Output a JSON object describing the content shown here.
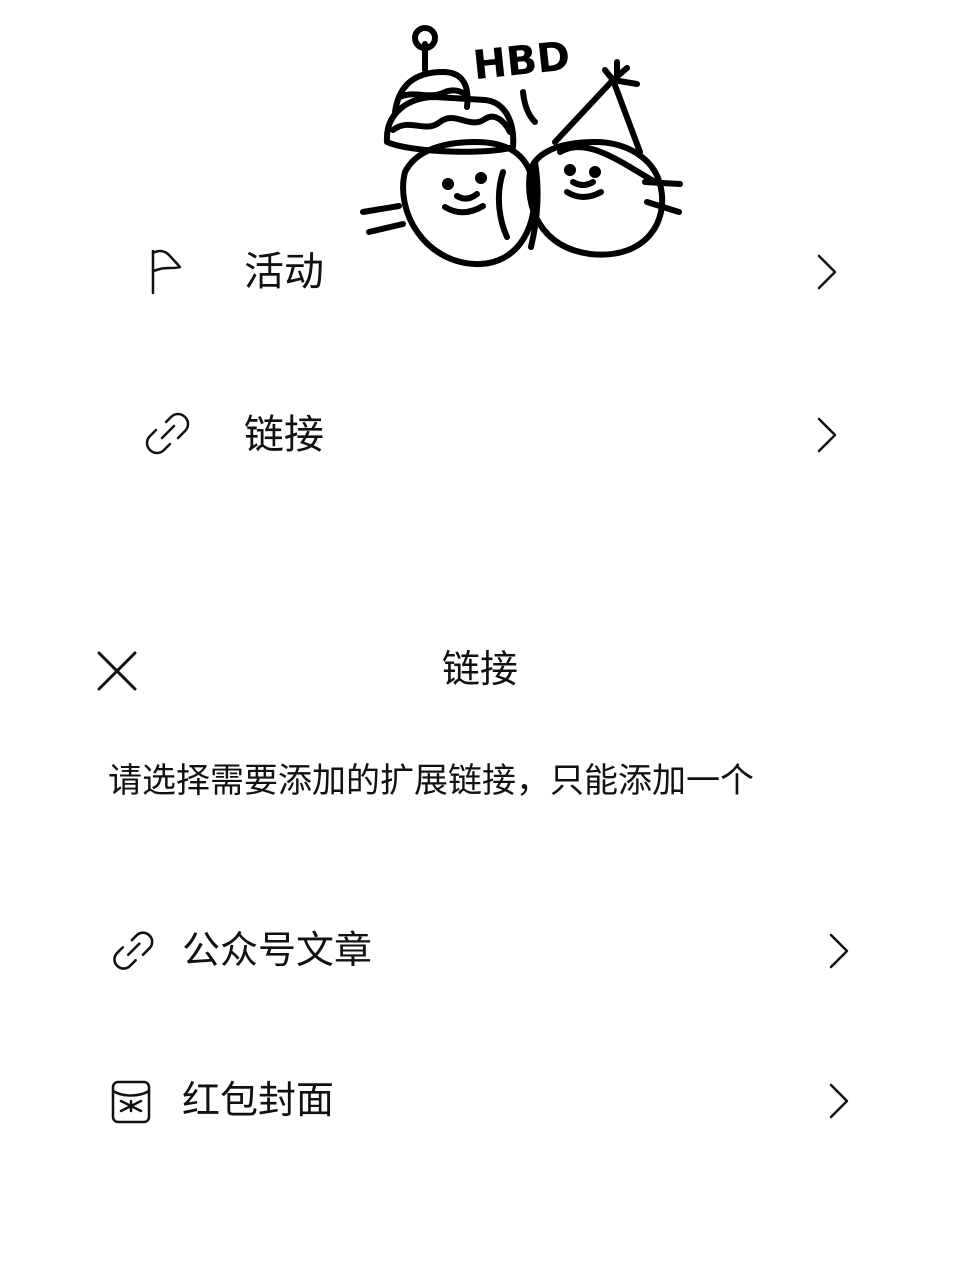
{
  "sticker": {
    "text": "HBD"
  },
  "menu": {
    "items": [
      {
        "label": "活动",
        "icon": "flag-icon"
      },
      {
        "label": "链接",
        "icon": "link-icon"
      }
    ]
  },
  "sheet": {
    "title": "链接",
    "description": "请选择需要添加的扩展链接，只能添加一个",
    "options": [
      {
        "label": "公众号文章",
        "icon": "link-icon"
      },
      {
        "label": "红包封面",
        "icon": "red-envelope-icon"
      }
    ]
  }
}
